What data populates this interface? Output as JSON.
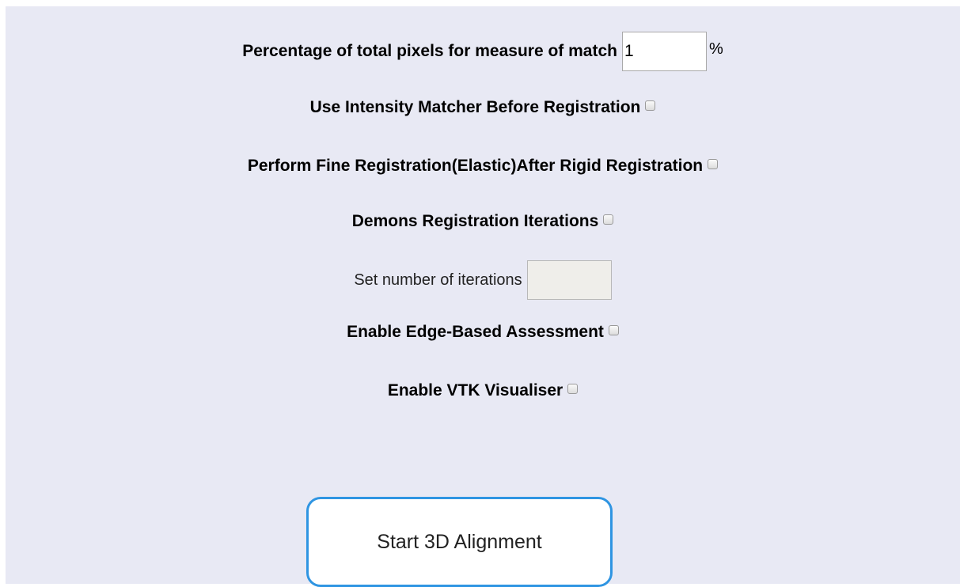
{
  "form": {
    "pixels_label": "Percentage of total pixels for measure of match",
    "pixels_value": "1",
    "pixels_unit": "%",
    "intensity_label": "Use Intensity Matcher Before Registration",
    "intensity_checked": false,
    "fine_reg_label": "Perform Fine Registration(Elastic)After Rigid Registration",
    "fine_reg_checked": false,
    "demons_label": "Demons Registration Iterations",
    "demons_checked": false,
    "iterations_label": "Set number of iterations",
    "iterations_value": "",
    "edge_label": "Enable Edge-Based Assessment",
    "edge_checked": false,
    "vtk_label": "Enable VTK Visualiser",
    "vtk_checked": false
  },
  "actions": {
    "start_label": "Start 3D Alignment"
  },
  "colors": {
    "panel_background": "#e8e9f4",
    "button_border": "#2f95e2",
    "disabled_input_background": "#efeeea"
  }
}
